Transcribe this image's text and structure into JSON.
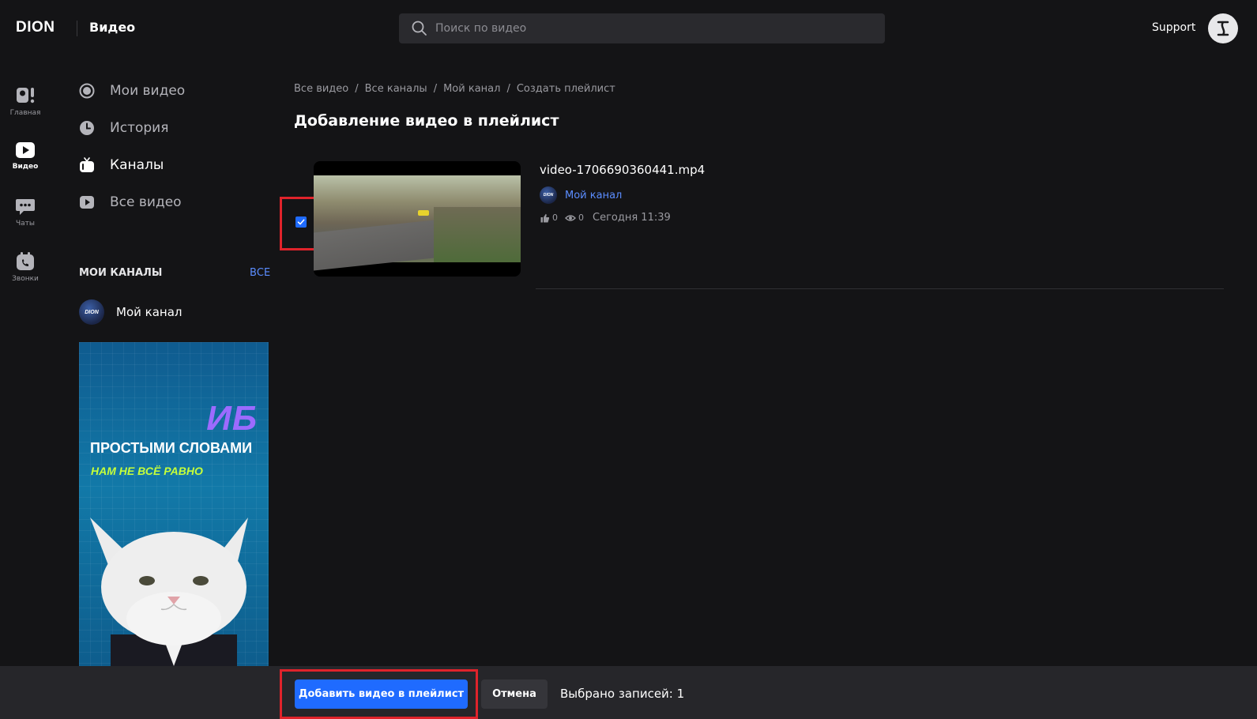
{
  "header": {
    "logo": "DION",
    "section": "Видео",
    "search_placeholder": "Поиск по видео",
    "support": "Support"
  },
  "rail": [
    {
      "label": "Главная",
      "icon": "home-icon",
      "active": false
    },
    {
      "label": "Видео",
      "icon": "video-play-icon",
      "active": true
    },
    {
      "label": "Чаты",
      "icon": "chat-icon",
      "active": false
    },
    {
      "label": "Звонки",
      "icon": "calls-icon",
      "active": false
    }
  ],
  "nav": [
    {
      "label": "Мои видео",
      "icon": "my-videos-icon",
      "active": false
    },
    {
      "label": "История",
      "icon": "history-clock-icon",
      "active": false
    },
    {
      "label": "Каналы",
      "icon": "channels-tv-icon",
      "active": true
    },
    {
      "label": "Все видео",
      "icon": "all-videos-play-icon",
      "active": false
    }
  ],
  "my_channels": {
    "heading": "МОИ КАНАЛЫ",
    "all_link": "ВСЕ",
    "items": [
      {
        "name": "Мой канал",
        "avatar_text": "DION"
      }
    ]
  },
  "banner": {
    "line1": "ИБ",
    "line2": "ПРОСТЫМИ СЛОВАМИ",
    "line3": "НАМ НЕ ВСЁ РАВНО"
  },
  "breadcrumb": [
    "Все видео",
    "Все каналы",
    "Мой канал",
    "Создать плейлист"
  ],
  "page_title": "Добавление видео в плейлист",
  "video": {
    "checked": true,
    "title": "video-1706690360441.mp4",
    "channel": "Мой канал",
    "likes": "0",
    "views": "0",
    "date": "Сегодня 11:39"
  },
  "footer": {
    "add_button": "Добавить видео в плейлист",
    "cancel_button": "Отмена",
    "selected_text": "Выбрано записей: 1"
  },
  "colors": {
    "accent": "#1f6bff",
    "link": "#5b8dff",
    "highlight": "#e0232b",
    "background": "#141416"
  }
}
